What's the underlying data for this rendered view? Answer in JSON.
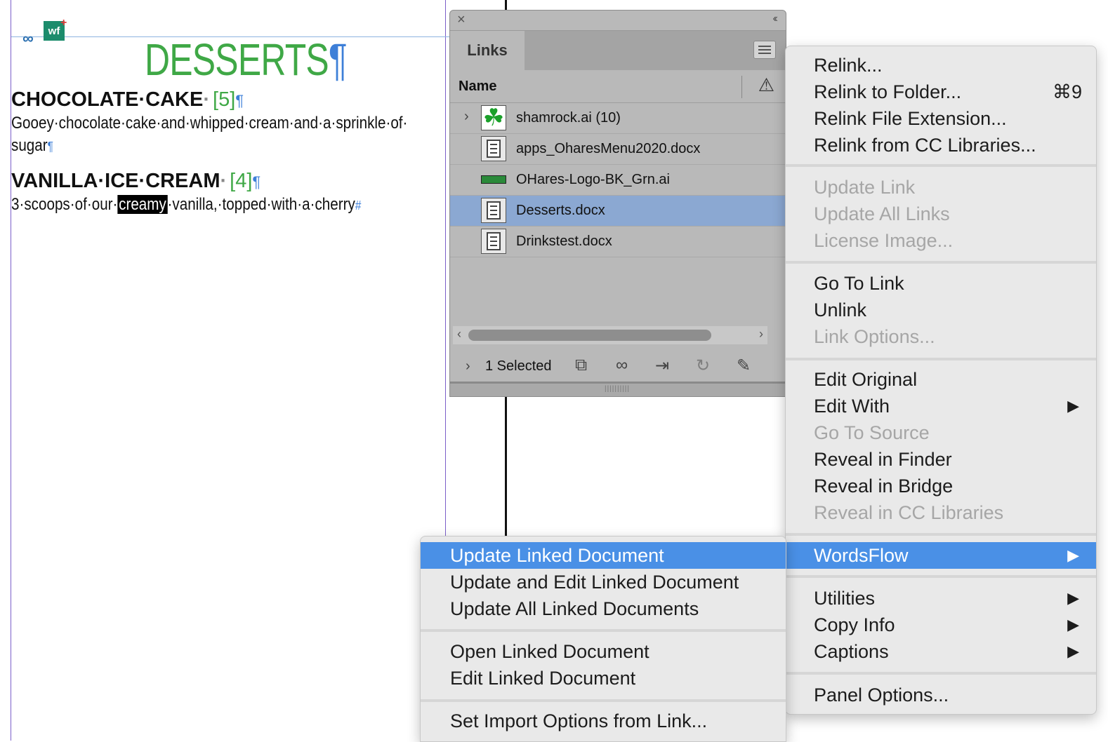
{
  "document": {
    "title": "DESSERTS",
    "pilcrow": "¶",
    "items": [
      {
        "name": "CHOCOLATE·CAKE",
        "count": "[5]",
        "desc": "Gooey·chocolate·cake·and·whipped·cream·and·a·sprinkle·of·",
        "desc2": "sugar"
      },
      {
        "name": "VANILLA·ICE·CREAM",
        "count": "[4]",
        "desc_before": "3·scoops·of·our·",
        "desc_selected": "creamy",
        "desc_after": "·vanilla,·topped·with·a·cherry"
      }
    ],
    "end_mark": "#",
    "badge_label": "wf"
  },
  "links_panel": {
    "tab_label": "Links",
    "column_name": "Name",
    "rows": [
      {
        "name": "shamrock.ai (10)",
        "type": "shamrock",
        "expandable": true,
        "selected": false
      },
      {
        "name": "apps_OharesMenu2020.docx",
        "type": "docx",
        "expandable": false,
        "selected": false
      },
      {
        "name": "OHares-Logo-BK_Grn.ai",
        "type": "logo",
        "expandable": false,
        "selected": false
      },
      {
        "name": "Desserts.docx",
        "type": "docx",
        "expandable": false,
        "selected": true
      },
      {
        "name": "Drinkstest.docx",
        "type": "docx",
        "expandable": false,
        "selected": false
      }
    ],
    "footer_status": "1 Selected",
    "footer_icons": [
      "relink-from-cc-icon",
      "relink-icon",
      "goto-link-icon",
      "update-link-icon",
      "edit-original-icon"
    ]
  },
  "main_menu": {
    "items": [
      {
        "label": "Relink...",
        "shortcut": "",
        "state": "enabled"
      },
      {
        "label": "Relink to Folder...",
        "shortcut": "⌘9",
        "state": "enabled"
      },
      {
        "label": "Relink File Extension...",
        "shortcut": "",
        "state": "enabled"
      },
      {
        "label": "Relink from CC Libraries...",
        "shortcut": "",
        "state": "enabled"
      },
      {
        "label": "Update Link",
        "shortcut": "",
        "state": "disabled"
      },
      {
        "label": "Update All Links",
        "shortcut": "",
        "state": "disabled"
      },
      {
        "label": "License Image...",
        "shortcut": "",
        "state": "disabled"
      },
      {
        "label": "Go To Link",
        "shortcut": "",
        "state": "enabled"
      },
      {
        "label": "Unlink",
        "shortcut": "",
        "state": "enabled"
      },
      {
        "label": "Link Options...",
        "shortcut": "",
        "state": "disabled"
      },
      {
        "label": "Edit Original",
        "shortcut": "",
        "state": "enabled"
      },
      {
        "label": "Edit With",
        "shortcut": "",
        "state": "submenu"
      },
      {
        "label": "Go To Source",
        "shortcut": "",
        "state": "disabled"
      },
      {
        "label": "Reveal in Finder",
        "shortcut": "",
        "state": "enabled"
      },
      {
        "label": "Reveal in Bridge",
        "shortcut": "",
        "state": "enabled"
      },
      {
        "label": "Reveal in CC Libraries",
        "shortcut": "",
        "state": "disabled"
      },
      {
        "label": "WordsFlow",
        "shortcut": "",
        "state": "highlighted-submenu"
      },
      {
        "label": "Utilities",
        "shortcut": "",
        "state": "submenu"
      },
      {
        "label": "Copy Info",
        "shortcut": "",
        "state": "submenu"
      },
      {
        "label": "Captions",
        "shortcut": "",
        "state": "submenu"
      },
      {
        "label": "Panel Options...",
        "shortcut": "",
        "state": "enabled"
      }
    ],
    "submenu_arrow": "▶"
  },
  "wordsflow_submenu": {
    "items": [
      {
        "label": "Update Linked Document",
        "state": "highlighted"
      },
      {
        "label": "Update and Edit Linked Document",
        "state": "enabled"
      },
      {
        "label": "Update All Linked Documents",
        "state": "enabled"
      },
      {
        "label": "Open Linked Document",
        "state": "enabled"
      },
      {
        "label": "Edit Linked Document",
        "state": "enabled"
      },
      {
        "label": "Set Import Options from Link...",
        "state": "enabled"
      }
    ]
  },
  "colors": {
    "title_green": "#3fa846",
    "count_green": "#3fa846",
    "menu_highlight": "#4a90e6",
    "selected_row": "#8ba8d2",
    "panel_bg": "#b9b9b9",
    "menu_bg": "#e9e9e9",
    "disabled_text": "#a6a6a6"
  }
}
